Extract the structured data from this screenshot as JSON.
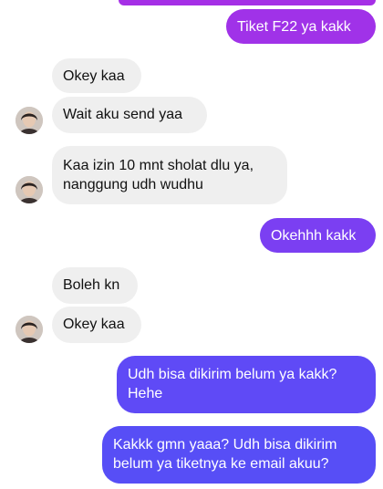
{
  "colors": {
    "incoming_bg": "#efefef",
    "outgoing_purple": "#9f2fe6",
    "outgoing_violet": "#7b3ff2",
    "outgoing_blue": "#5a4df6"
  },
  "messages": [
    {
      "side": "out",
      "text": "Tiket F22 ya kakk"
    },
    {
      "side": "in",
      "text": "Okey kaa"
    },
    {
      "side": "in",
      "text": "Wait aku send yaa",
      "avatar": "contact-avatar"
    },
    {
      "side": "in",
      "text": "Kaa izin 10 mnt sholat dlu ya,\nnanggung udh wudhu",
      "avatar": "contact-avatar"
    },
    {
      "side": "out",
      "text": "Okehhh kakk"
    },
    {
      "side": "in",
      "text": "Boleh kn"
    },
    {
      "side": "in",
      "text": "Okey kaa",
      "avatar": "contact-avatar"
    },
    {
      "side": "out",
      "text": "Udh bisa dikirim belum ya kakk?\nHehe"
    },
    {
      "side": "out",
      "text": "Kakkk gmn yaaa? Udh bisa dikirim\nbelum ya tiketnya ke email akuu?"
    }
  ]
}
